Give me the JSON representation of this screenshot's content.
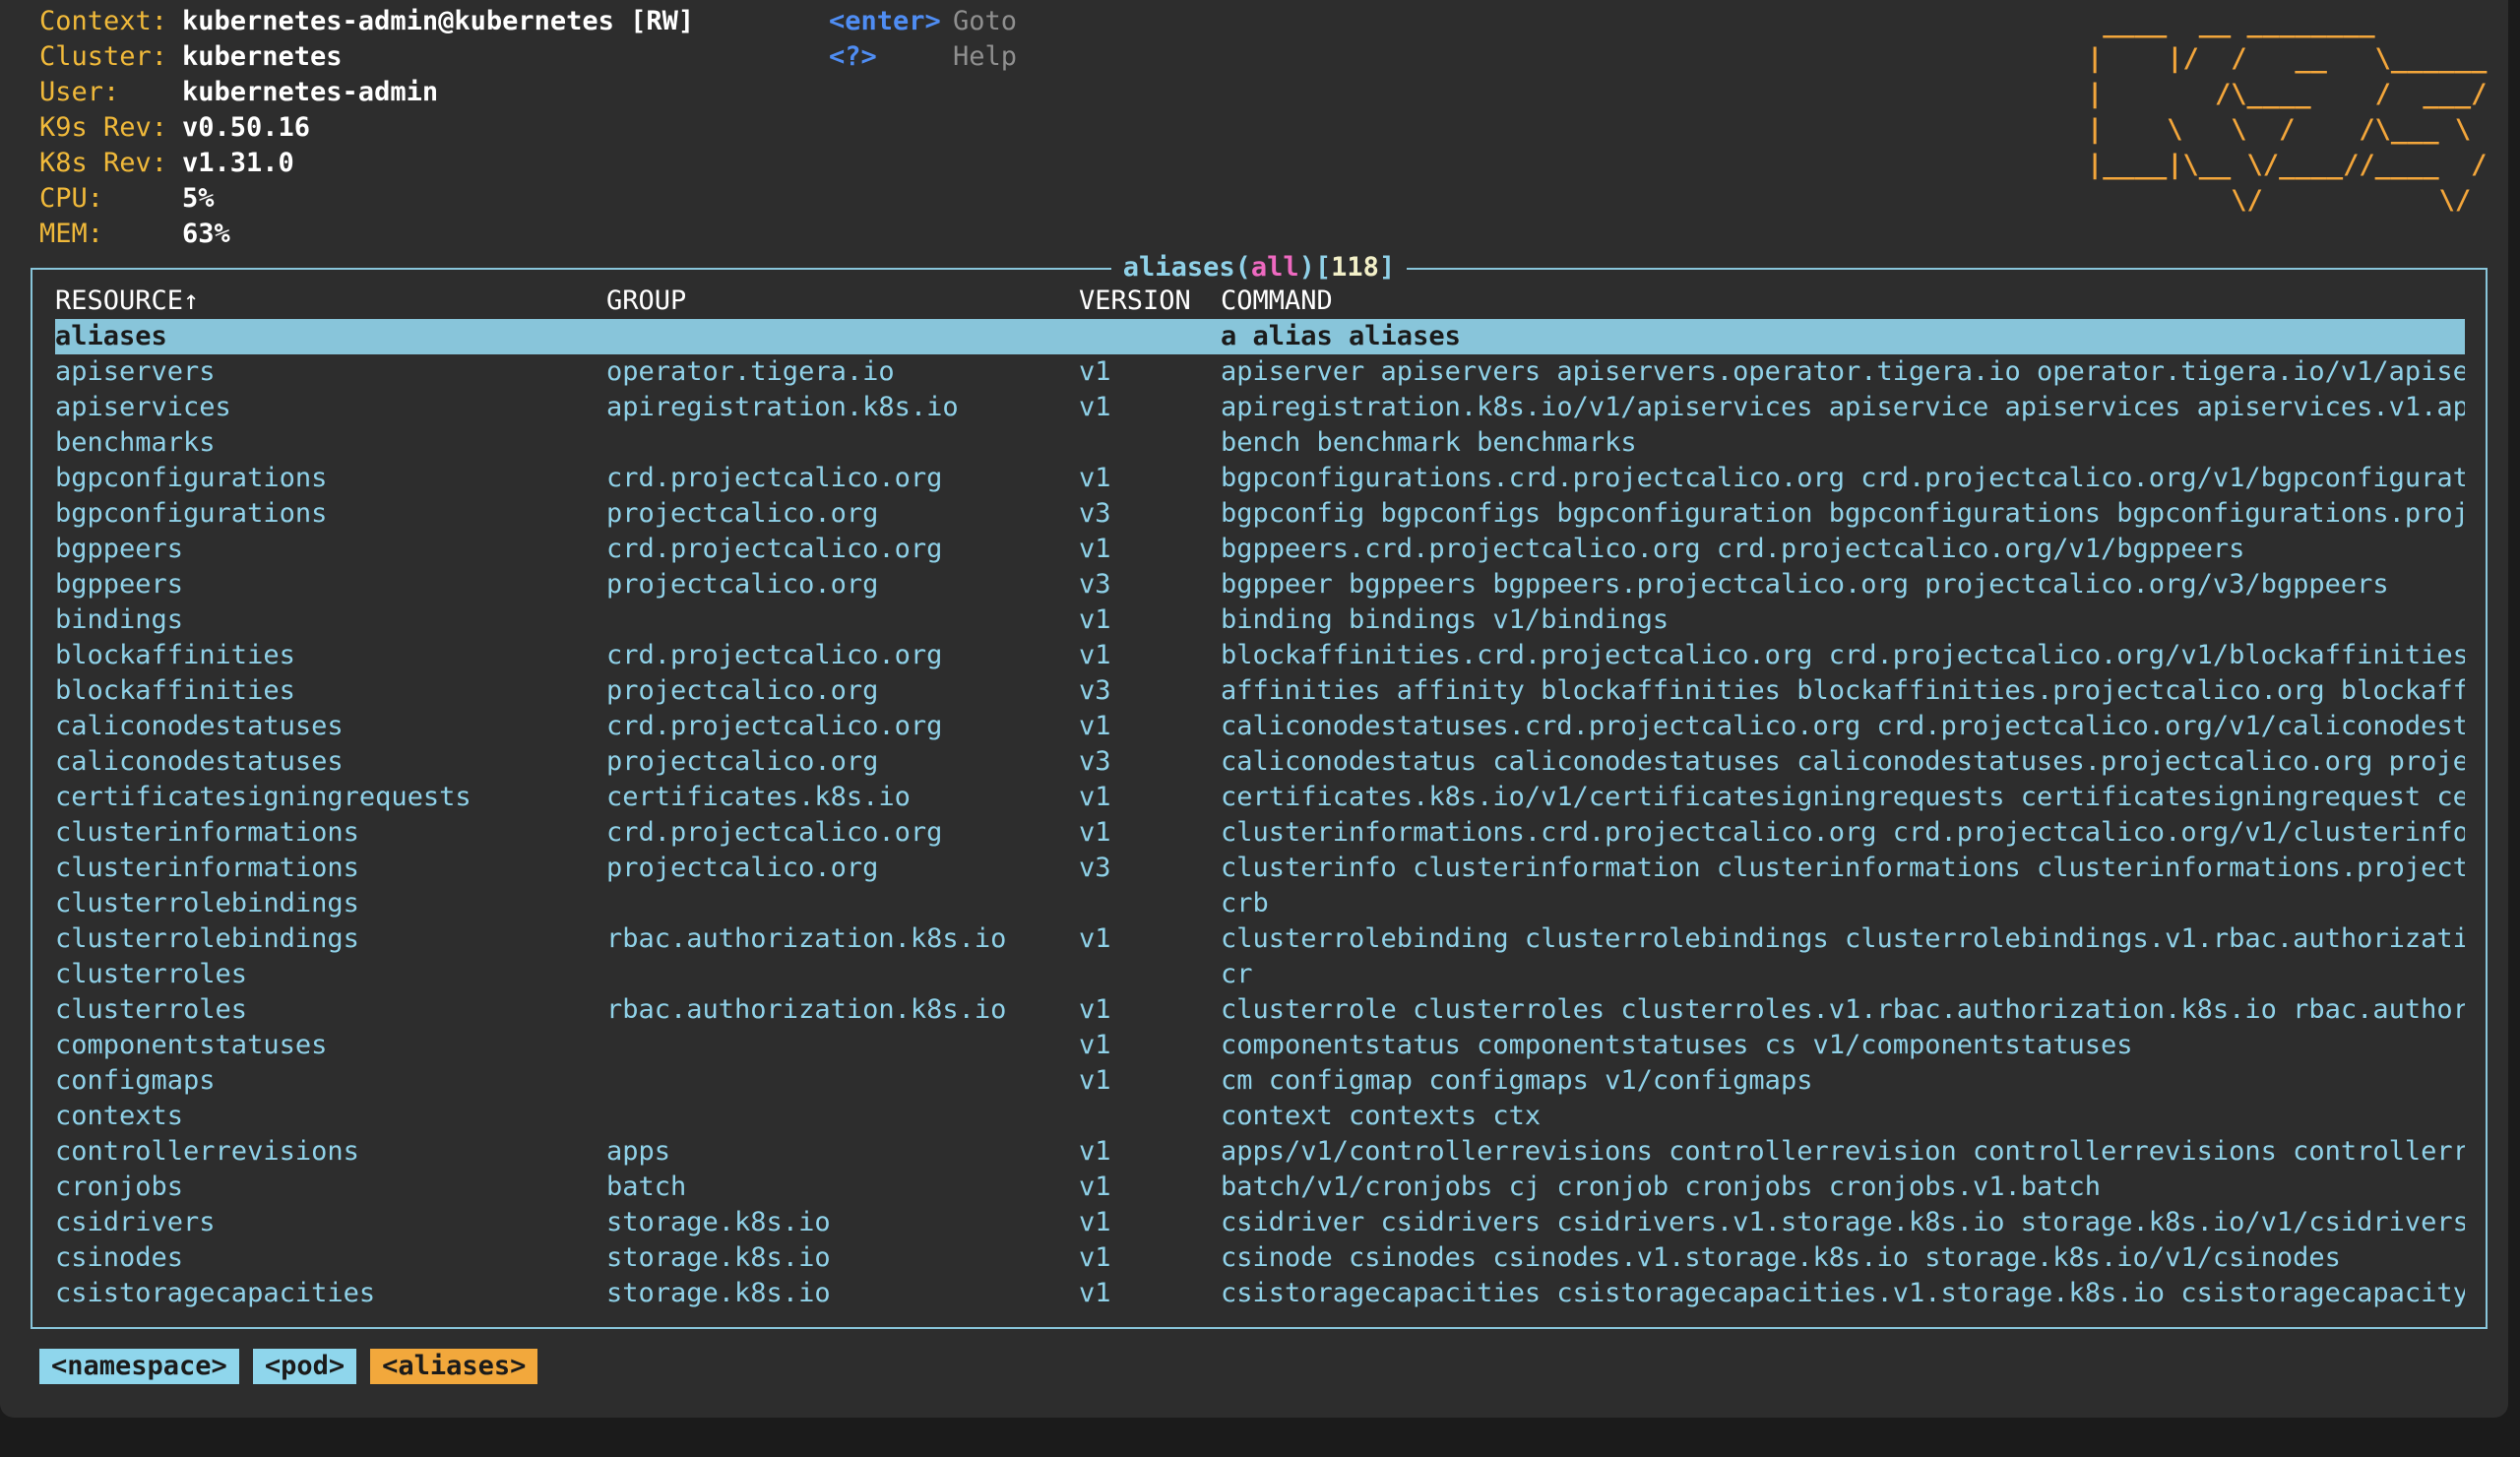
{
  "info": [
    {
      "key": "Context:",
      "value": "kubernetes-admin@kubernetes [RW]"
    },
    {
      "key": "Cluster:",
      "value": "kubernetes"
    },
    {
      "key": "User:",
      "value": "kubernetes-admin"
    },
    {
      "key": "K9s Rev:",
      "value": "v0.50.16"
    },
    {
      "key": "K8s Rev:",
      "value": "v1.31.0"
    },
    {
      "key": "CPU:",
      "value": "5%"
    },
    {
      "key": "MEM:",
      "value": "63%"
    }
  ],
  "keys": [
    {
      "code": "<enter>",
      "desc": "Goto"
    },
    {
      "code": "<?>",
      "desc": "Help"
    }
  ],
  "logo": " ____  __ ________       \n|    |/  /   __   \\______\n|       /\\____    /  ___/\n|    \\   \\  /    /\\___ \\ \n|____|\\__ \\/____//____  /\n         \\/           \\/ ",
  "panel": {
    "name": "aliases",
    "ns": "all",
    "count": "118"
  },
  "columns": {
    "resource": "RESOURCE↑",
    "group": "GROUP",
    "version": "VERSION",
    "command": "COMMAND"
  },
  "rows": [
    {
      "resource": "aliases",
      "group": "",
      "version": "",
      "command": "a alias aliases",
      "selected": true
    },
    {
      "resource": "apiservers",
      "group": "operator.tigera.io",
      "version": "v1",
      "command": "apiserver apiservers apiservers.operator.tigera.io operator.tigera.io/v1/apiser"
    },
    {
      "resource": "apiservices",
      "group": "apiregistration.k8s.io",
      "version": "v1",
      "command": "apiregistration.k8s.io/v1/apiservices apiservice apiservices apiservices.v1.api"
    },
    {
      "resource": "benchmarks",
      "group": "",
      "version": "",
      "command": "bench benchmark benchmarks"
    },
    {
      "resource": "bgpconfigurations",
      "group": "crd.projectcalico.org",
      "version": "v1",
      "command": "bgpconfigurations.crd.projectcalico.org crd.projectcalico.org/v1/bgpconfigurati"
    },
    {
      "resource": "bgpconfigurations",
      "group": "projectcalico.org",
      "version": "v3",
      "command": "bgpconfig bgpconfigs bgpconfiguration bgpconfigurations bgpconfigurations.proje"
    },
    {
      "resource": "bgppeers",
      "group": "crd.projectcalico.org",
      "version": "v1",
      "command": "bgppeers.crd.projectcalico.org crd.projectcalico.org/v1/bgppeers"
    },
    {
      "resource": "bgppeers",
      "group": "projectcalico.org",
      "version": "v3",
      "command": "bgppeer bgppeers bgppeers.projectcalico.org projectcalico.org/v3/bgppeers"
    },
    {
      "resource": "bindings",
      "group": "",
      "version": "v1",
      "command": "binding bindings v1/bindings"
    },
    {
      "resource": "blockaffinities",
      "group": "crd.projectcalico.org",
      "version": "v1",
      "command": "blockaffinities.crd.projectcalico.org crd.projectcalico.org/v1/blockaffinities"
    },
    {
      "resource": "blockaffinities",
      "group": "projectcalico.org",
      "version": "v3",
      "command": "affinities affinity blockaffinities blockaffinities.projectcalico.org blockaffi"
    },
    {
      "resource": "caliconodestatuses",
      "group": "crd.projectcalico.org",
      "version": "v1",
      "command": "caliconodestatuses.crd.projectcalico.org crd.projectcalico.org/v1/caliconodesta"
    },
    {
      "resource": "caliconodestatuses",
      "group": "projectcalico.org",
      "version": "v3",
      "command": "caliconodestatus caliconodestatuses caliconodestatuses.projectcalico.org projec"
    },
    {
      "resource": "certificatesigningrequests",
      "group": "certificates.k8s.io",
      "version": "v1",
      "command": "certificates.k8s.io/v1/certificatesigningrequests certificatesigningrequest cer"
    },
    {
      "resource": "clusterinformations",
      "group": "crd.projectcalico.org",
      "version": "v1",
      "command": "clusterinformations.crd.projectcalico.org crd.projectcalico.org/v1/clusterinfor"
    },
    {
      "resource": "clusterinformations",
      "group": "projectcalico.org",
      "version": "v3",
      "command": "clusterinfo clusterinformation clusterinformations clusterinformations.projectc"
    },
    {
      "resource": "clusterrolebindings",
      "group": "",
      "version": "",
      "command": "crb"
    },
    {
      "resource": "clusterrolebindings",
      "group": "rbac.authorization.k8s.io",
      "version": "v1",
      "command": "clusterrolebinding clusterrolebindings clusterrolebindings.v1.rbac.authorizatio"
    },
    {
      "resource": "clusterroles",
      "group": "",
      "version": "",
      "command": "cr"
    },
    {
      "resource": "clusterroles",
      "group": "rbac.authorization.k8s.io",
      "version": "v1",
      "command": "clusterrole clusterroles clusterroles.v1.rbac.authorization.k8s.io rbac.authori"
    },
    {
      "resource": "componentstatuses",
      "group": "",
      "version": "v1",
      "command": "componentstatus componentstatuses cs v1/componentstatuses"
    },
    {
      "resource": "configmaps",
      "group": "",
      "version": "v1",
      "command": "cm configmap configmaps v1/configmaps"
    },
    {
      "resource": "contexts",
      "group": "",
      "version": "",
      "command": "context contexts ctx"
    },
    {
      "resource": "controllerrevisions",
      "group": "apps",
      "version": "v1",
      "command": "apps/v1/controllerrevisions controllerrevision controllerrevisions controllerre"
    },
    {
      "resource": "cronjobs",
      "group": "batch",
      "version": "v1",
      "command": "batch/v1/cronjobs cj cronjob cronjobs cronjobs.v1.batch"
    },
    {
      "resource": "csidrivers",
      "group": "storage.k8s.io",
      "version": "v1",
      "command": "csidriver csidrivers csidrivers.v1.storage.k8s.io storage.k8s.io/v1/csidrivers"
    },
    {
      "resource": "csinodes",
      "group": "storage.k8s.io",
      "version": "v1",
      "command": "csinode csinodes csinodes.v1.storage.k8s.io storage.k8s.io/v1/csinodes"
    },
    {
      "resource": "csistoragecapacities",
      "group": "storage.k8s.io",
      "version": "v1",
      "command": "csistoragecapacities csistoragecapacities.v1.storage.k8s.io csistoragecapacity"
    }
  ],
  "crumbs": [
    {
      "label": "<namespace>",
      "active": false
    },
    {
      "label": "<pod>",
      "active": false
    },
    {
      "label": "<aliases>",
      "active": true
    }
  ]
}
